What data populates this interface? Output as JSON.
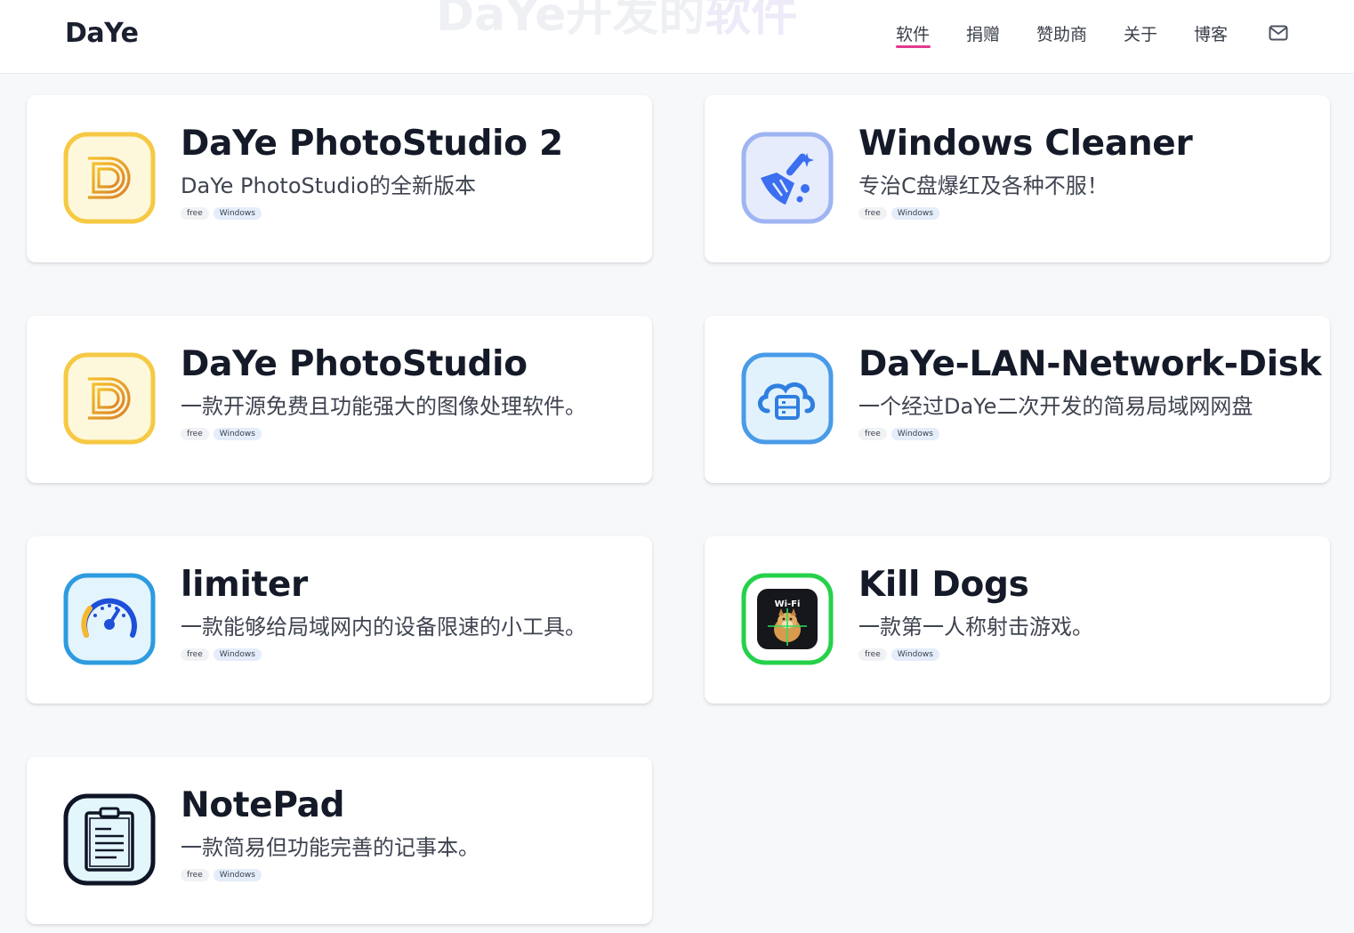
{
  "header": {
    "logo": "DaYe",
    "hero_ghost": "DaYe开发的",
    "hero_ghost_accent": "软件",
    "nav": [
      {
        "label": "软件",
        "active": true
      },
      {
        "label": "捐赠"
      },
      {
        "label": "赞助商"
      },
      {
        "label": "关于"
      },
      {
        "label": "博客"
      }
    ],
    "mail_icon": "mail-icon",
    "active_color": "#e23a8d"
  },
  "apps": [
    {
      "title": "DaYe PhotoStudio 2",
      "description": "DaYe PhotoStudio的全新版本",
      "tags": [
        "free",
        "Windows"
      ],
      "icon": "photostudio-d-logo-icon"
    },
    {
      "title": "Windows Cleaner",
      "description": "专治C盘爆红及各种不服！",
      "tags": [
        "free",
        "Windows"
      ],
      "icon": "broom-icon"
    },
    {
      "title": "DaYe PhotoStudio",
      "description": "一款开源免费且功能强大的图像处理软件。",
      "tags": [
        "free",
        "Windows"
      ],
      "icon": "photostudio-d-logo-icon"
    },
    {
      "title": "DaYe-LAN-Network-Disk",
      "description": "一个经过DaYe二次开发的简易局域网网盘",
      "tags": [
        "free",
        "Windows"
      ],
      "icon": "cloud-server-icon"
    },
    {
      "title": "limiter",
      "description": "一款能够给局域网内的设备限速的小工具。",
      "tags": [
        "free",
        "Windows"
      ],
      "icon": "speedometer-icon"
    },
    {
      "title": "Kill Dogs",
      "description": "一款第一人称射击游戏。",
      "tags": [
        "free",
        "Windows"
      ],
      "icon": "wifi-dog-crosshair-icon",
      "icon_text": "Wi-Fi"
    },
    {
      "title": "NotePad",
      "description": "一款简易但功能完善的记事本。",
      "tags": [
        "free",
        "Windows"
      ],
      "icon": "clipboard-notepad-icon"
    }
  ]
}
